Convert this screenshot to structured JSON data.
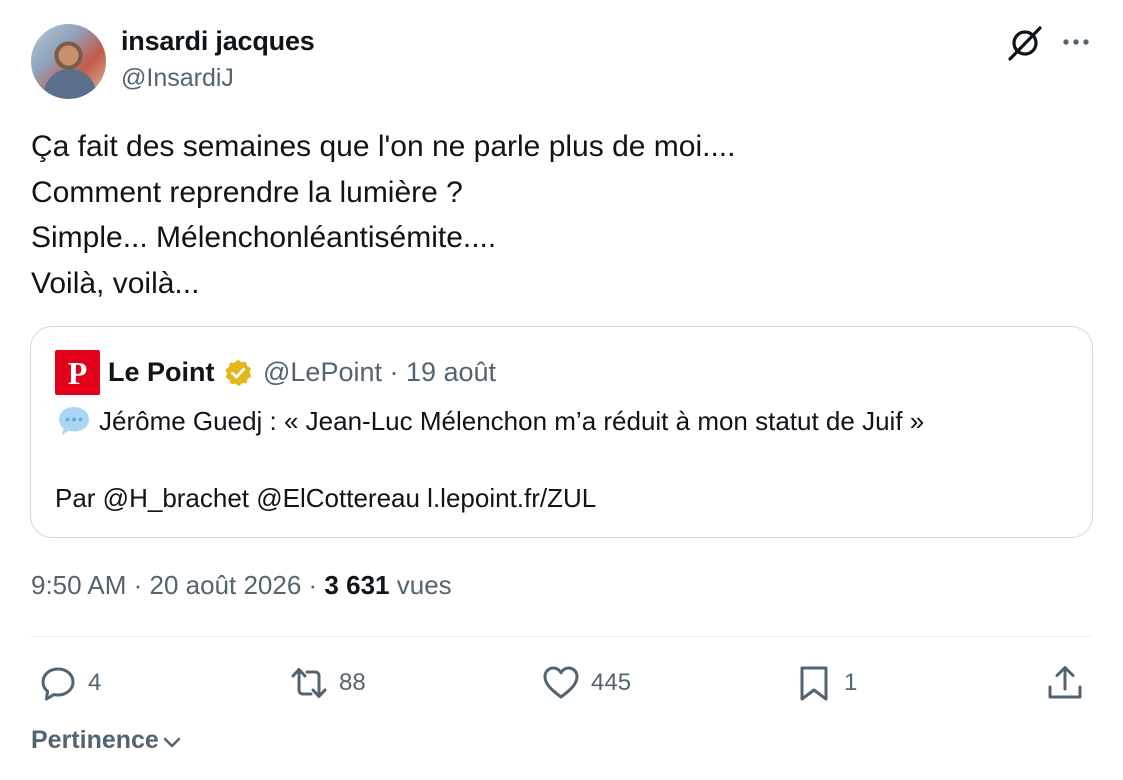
{
  "author": {
    "name": "insardi jacques",
    "handle": "@InsardiJ"
  },
  "tweet": {
    "lines": [
      "Ça fait des semaines que l'on ne parle plus de moi....",
      "Comment reprendre la lumière ?",
      "Simple... Mélenchonléantisémite....",
      "Voilà, voilà..."
    ]
  },
  "quote": {
    "logo_letter": "P",
    "name": "Le Point",
    "handle_date": "@LePoint · 19 août",
    "text": "Jérôme Guedj : « Jean-Luc Mélenchon m’a réduit à mon statut de Juif »",
    "credits": "Par @H_brachet @ElCottereau l.lepoint.fr/ZUL",
    "brand_color": "#e3001b",
    "badge_color": "#e2b719"
  },
  "meta": {
    "time_date": "9:50 AM · 20 août 2026 · ",
    "views_count": "3 631",
    "views_label": "vues"
  },
  "actions": {
    "replies": "4",
    "reposts": "88",
    "likes": "445",
    "bookmarks": "1"
  },
  "sort": {
    "label": "Pertinence"
  },
  "icons": {
    "grok": "grok-icon",
    "more": "more-dots-icon",
    "reply": "reply-icon",
    "repost": "repost-icon",
    "like": "heart-icon",
    "bookmark": "bookmark-icon",
    "share": "share-icon",
    "verified": "verified-badge-icon",
    "speech": "speech-bubble-icon"
  },
  "colors": {
    "text": "#0f1419",
    "secondary": "#536471",
    "border": "#cfd9de"
  }
}
